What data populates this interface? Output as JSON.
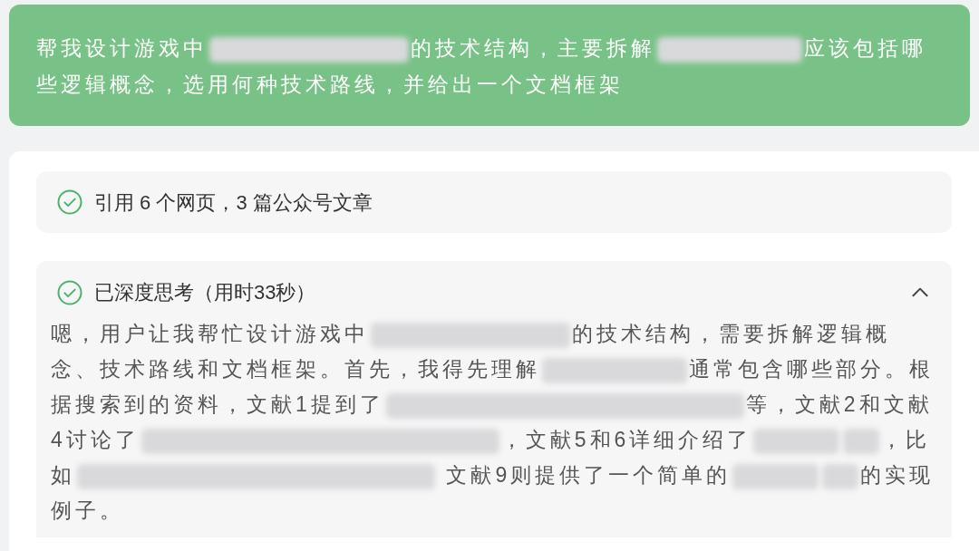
{
  "prompt": {
    "segments": [
      {
        "kind": "text",
        "text": "帮我设计游戏中"
      },
      {
        "kind": "blur-l"
      },
      {
        "kind": "text",
        "text": "的技术结构，主要拆解"
      },
      {
        "kind": "blur-m"
      },
      {
        "kind": "text",
        "text": "应该包括哪些逻辑概念，选用何种技术路线，并给出一个文档框架"
      }
    ]
  },
  "sources": {
    "label": "引用 6 个网页，3 篇公众号文章",
    "done": true
  },
  "thinking": {
    "title": "已深度思考（用时33秒）",
    "done": true,
    "expanded": true,
    "segments": [
      {
        "kind": "text",
        "text": "嗯，用户让我帮忙设计游戏中"
      },
      {
        "kind": "blur-l"
      },
      {
        "kind": "text",
        "text": "的技术结构，需要拆解逻辑概念、技术路线和文档框架。首先，我得先理解"
      },
      {
        "kind": "blur-m"
      },
      {
        "kind": "text",
        "text": "通常包含哪些部分。根据搜索到的资料，文献1提到了"
      },
      {
        "kind": "blur-xl"
      },
      {
        "kind": "text",
        "text": "等，文献2和文献4讨论了"
      },
      {
        "kind": "blur-xl"
      },
      {
        "kind": "text",
        "text": "，文献5和6详细介绍了"
      },
      {
        "kind": "blur-s"
      },
      {
        "kind": "blur-xs"
      },
      {
        "kind": "text",
        "text": "，比如"
      },
      {
        "kind": "blur-xl"
      },
      {
        "kind": "text",
        "text": " 文献9则提供了一个简单的"
      },
      {
        "kind": "blur-s"
      },
      {
        "kind": "blur-xs"
      },
      {
        "kind": "text",
        "text": "的实现例子。"
      }
    ]
  }
}
